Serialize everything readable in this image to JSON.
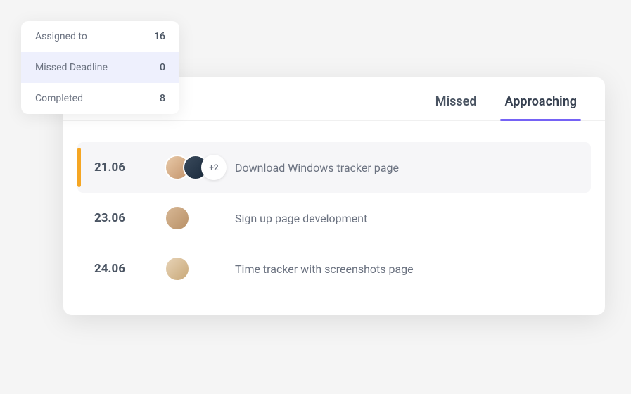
{
  "stats": {
    "items": [
      {
        "label": "Assigned to",
        "value": "16",
        "active": false
      },
      {
        "label": "Missed Deadline",
        "value": "0",
        "active": true
      },
      {
        "label": "Completed",
        "value": "8",
        "active": false
      }
    ]
  },
  "tabs": {
    "missed": "Missed",
    "approaching": "Approaching"
  },
  "tasks": [
    {
      "date": "21.06",
      "title": "Download Windows tracker page",
      "more_count": "+2",
      "highlighted": true
    },
    {
      "date": "23.06",
      "title": "Sign up page development",
      "highlighted": false
    },
    {
      "date": "24.06",
      "title": "Time tracker with screenshots page",
      "highlighted": false
    }
  ]
}
